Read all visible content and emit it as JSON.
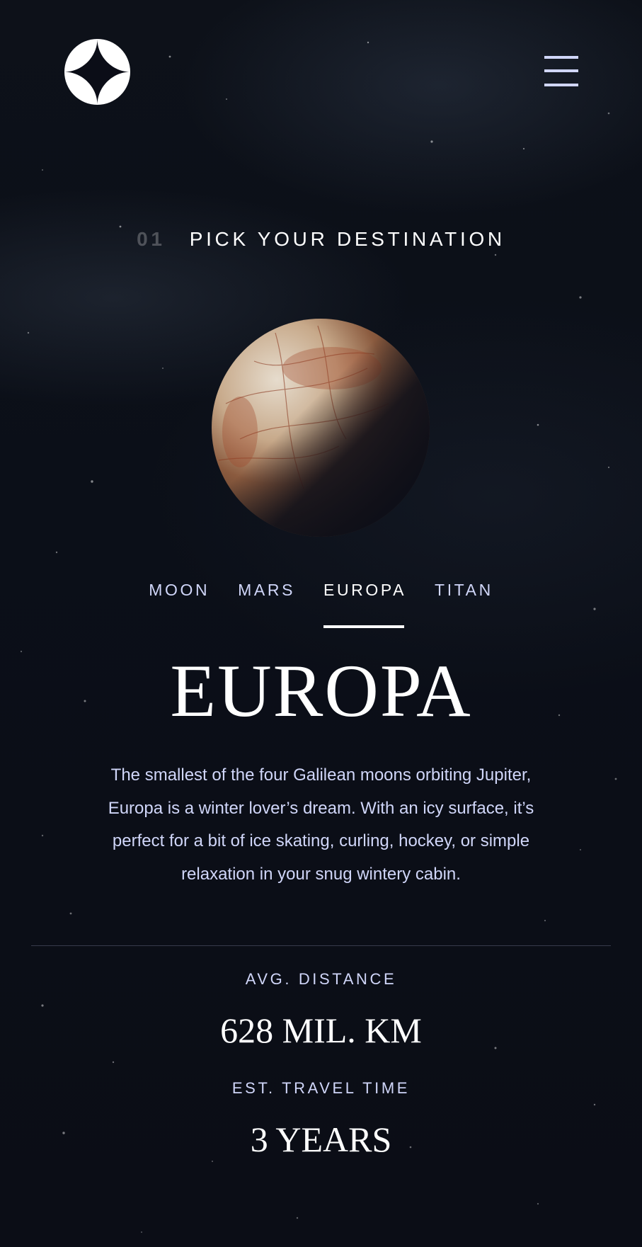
{
  "header": {
    "logo_icon": "star-logo-icon",
    "menu_icon": "hamburger-menu-icon"
  },
  "section": {
    "number": "01",
    "title": "Pick your destination"
  },
  "planet": {
    "name": "Europa",
    "icon": "europa-planet-image"
  },
  "tabs": [
    {
      "label": "Moon",
      "active": false
    },
    {
      "label": "Mars",
      "active": false
    },
    {
      "label": "Europa",
      "active": true
    },
    {
      "label": "Titan",
      "active": false
    }
  ],
  "destination": {
    "title": "Europa",
    "description": "The smallest of the four Galilean moons orbiting Jupiter, Europa is a winter lover’s dream. With an icy surface, it’s perfect for a bit of ice skating, curling, hockey, or simple relaxation in your snug wintery cabin.",
    "stats": [
      {
        "label": "Avg. distance",
        "value": "628 mil. km"
      },
      {
        "label": "Est. travel time",
        "value": "3 years"
      }
    ]
  },
  "colors": {
    "background": "#0b0d17",
    "accent_light": "#d0d6f9",
    "white": "#ffffff",
    "divider": "#383b4b"
  }
}
